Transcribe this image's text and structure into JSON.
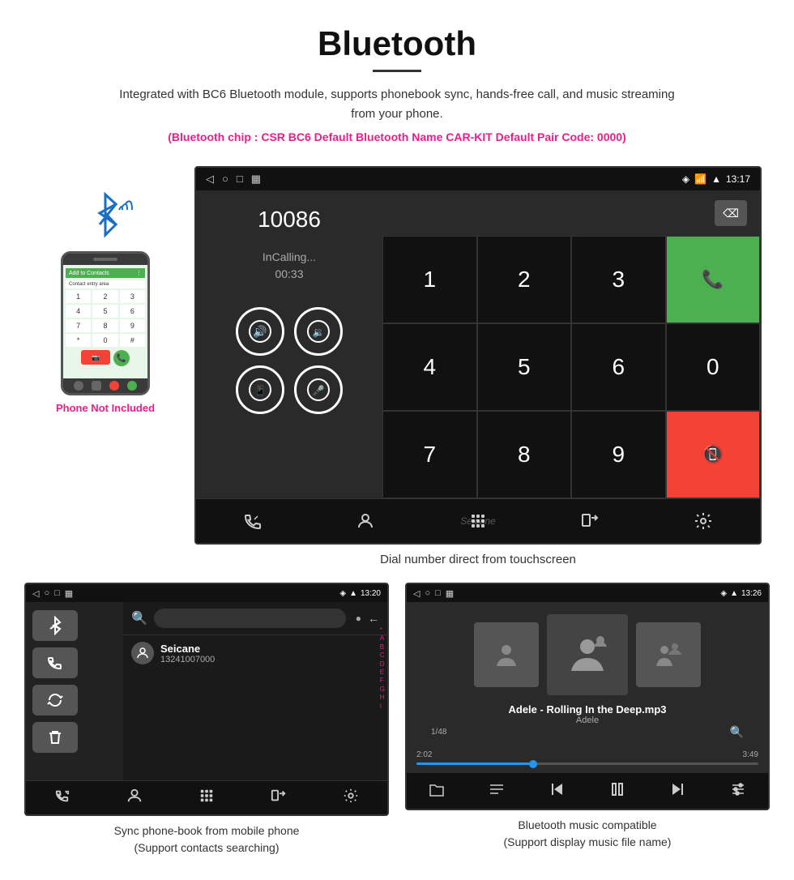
{
  "header": {
    "title": "Bluetooth",
    "subtitle": "Integrated with BC6 Bluetooth module, supports phonebook sync, hands-free call, and music streaming from your phone.",
    "specs": "(Bluetooth chip : CSR BC6    Default Bluetooth Name CAR-KIT    Default Pair Code: 0000)"
  },
  "phone": {
    "not_included": "Phone Not Included",
    "keys": [
      "1",
      "2",
      "3",
      "4",
      "5",
      "6",
      "7",
      "8",
      "9",
      "*",
      "0",
      "#"
    ]
  },
  "main_screen": {
    "status_time": "13:17",
    "call_number": "10086",
    "call_status": "InCalling...",
    "call_duration": "00:33",
    "numpad": [
      "1",
      "2",
      "3",
      "*",
      "4",
      "5",
      "6",
      "0",
      "7",
      "8",
      "9",
      "#"
    ],
    "caption": "Dial number direct from touchscreen"
  },
  "phonebook_screen": {
    "status_time": "13:20",
    "contact_name": "Seicane",
    "contact_number": "13241007000",
    "alphabet": [
      "*",
      "A",
      "B",
      "C",
      "D",
      "E",
      "F",
      "G",
      "H",
      "I"
    ],
    "caption_line1": "Sync phone-book from mobile phone",
    "caption_line2": "(Support contacts searching)"
  },
  "music_screen": {
    "status_time": "13:26",
    "song_title": "Adele - Rolling In the Deep.mp3",
    "artist": "Adele",
    "track_info": "1/48",
    "time_current": "2:02",
    "time_total": "3:49",
    "progress_percent": 35,
    "caption_line1": "Bluetooth music compatible",
    "caption_line2": "(Support display music file name)"
  },
  "bottom_nav": {
    "items": [
      "📞",
      "👤",
      "⬛",
      "📱",
      "⚙"
    ]
  }
}
